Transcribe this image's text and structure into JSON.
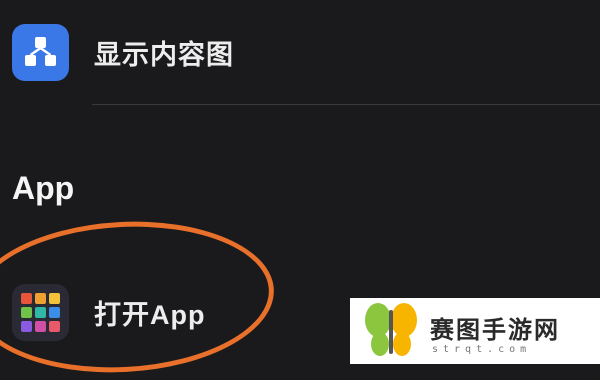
{
  "list": {
    "item_show_content_graph": {
      "label": "显示内容图",
      "icon": "content-graph-icon",
      "icon_color": "#3a78e8"
    },
    "section_title": "App",
    "item_open_app": {
      "label": "打开App",
      "icon": "app-grid-icon",
      "icon_colors": [
        "#e8553a",
        "#f0a030",
        "#f2c23a",
        "#6fc24a",
        "#2fb8a8",
        "#3a8ee8",
        "#8a5ae0",
        "#d050a8",
        "#e85a6a"
      ]
    }
  },
  "annotation": {
    "color": "#e8702a",
    "shape": "ellipse"
  },
  "watermark": {
    "text": "赛图手游网",
    "subtext": "strqt.com",
    "logo": "butterfly-logo",
    "logo_colors": [
      "#8cc63f",
      "#f7b500"
    ]
  }
}
